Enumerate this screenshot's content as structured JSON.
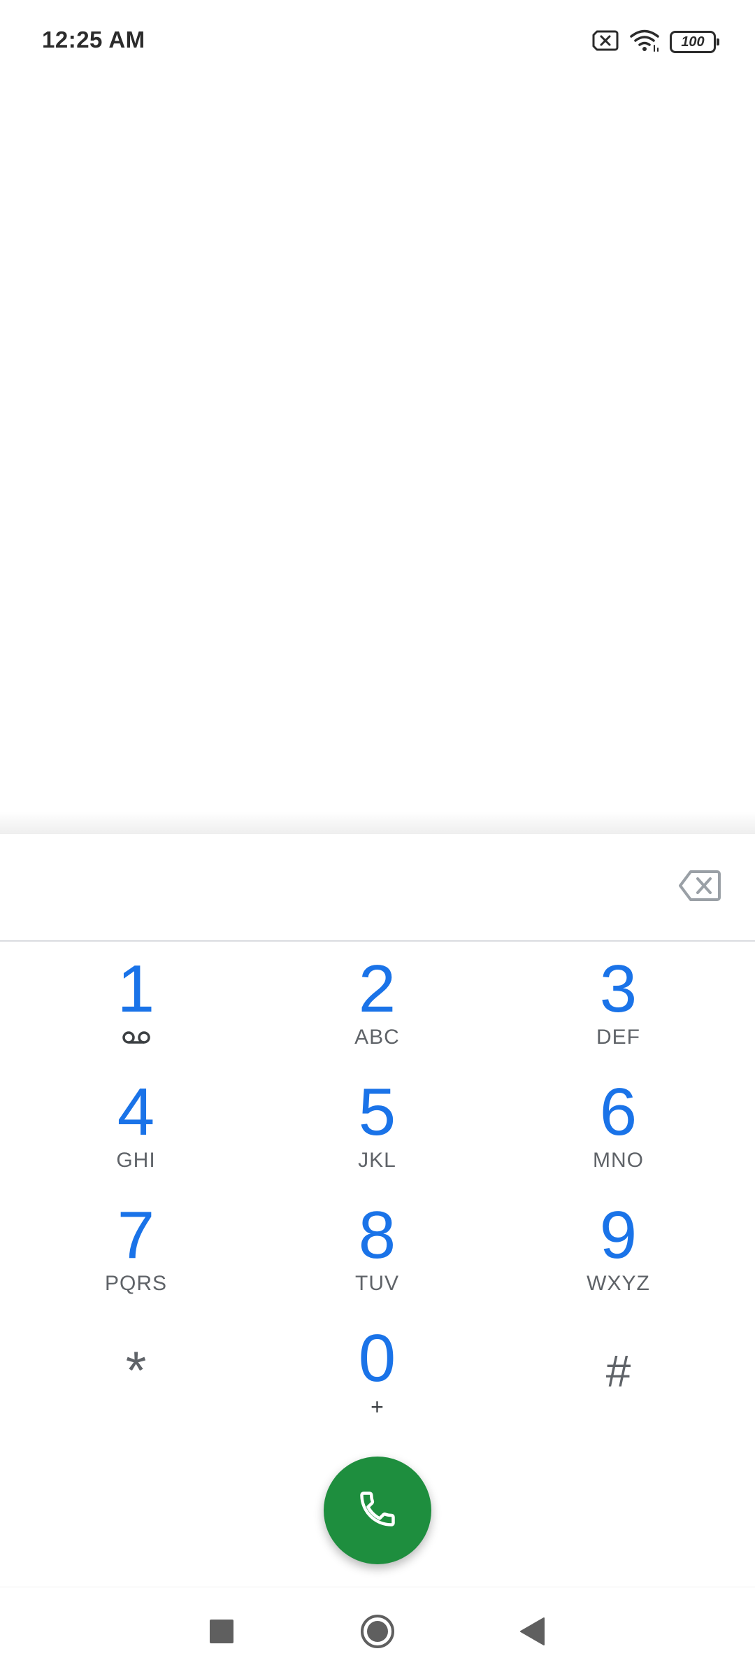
{
  "status_bar": {
    "time": "12:25 AM",
    "battery_level": "100",
    "icons": [
      "no-sim-icon",
      "wifi-icon",
      "battery-icon"
    ]
  },
  "dialer": {
    "digits_value": "",
    "keys": [
      {
        "digit": "1",
        "letters": "",
        "sub_icon": "voicemail-icon"
      },
      {
        "digit": "2",
        "letters": "ABC"
      },
      {
        "digit": "3",
        "letters": "DEF"
      },
      {
        "digit": "4",
        "letters": "GHI"
      },
      {
        "digit": "5",
        "letters": "JKL"
      },
      {
        "digit": "6",
        "letters": "MNO"
      },
      {
        "digit": "7",
        "letters": "PQRS"
      },
      {
        "digit": "8",
        "letters": "TUV"
      },
      {
        "digit": "9",
        "letters": "WXYZ"
      },
      {
        "symbol": "*"
      },
      {
        "digit": "0",
        "letters": "+"
      },
      {
        "symbol": "#"
      }
    ],
    "call_button_icon": "phone-icon",
    "backspace_icon": "backspace-icon"
  },
  "colors": {
    "digit": "#1a73e8",
    "letters": "#5f6368",
    "call_fab": "#1e8e3e",
    "divider": "#dadce0"
  },
  "nav_bar": {
    "icons": [
      "recents-square-icon",
      "home-circle-icon",
      "back-triangle-icon"
    ]
  }
}
